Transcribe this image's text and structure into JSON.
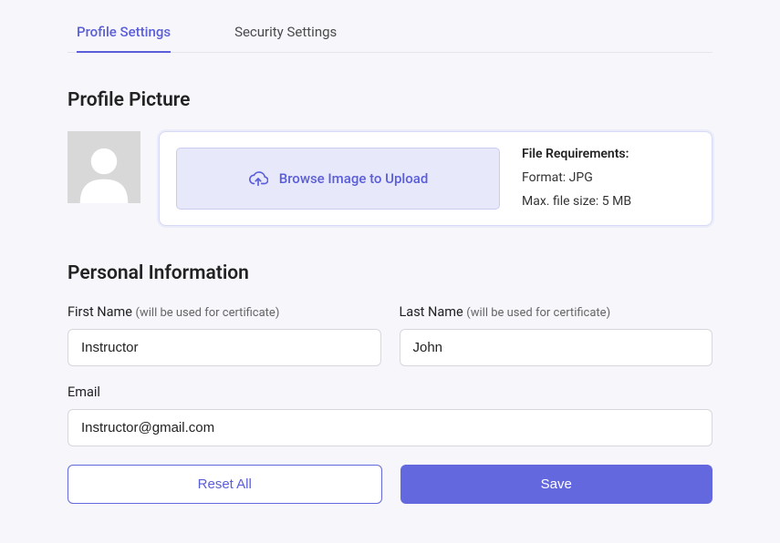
{
  "tabs": {
    "profile": "Profile Settings",
    "security": "Security Settings"
  },
  "profile_picture": {
    "title": "Profile Picture",
    "browse_label": "Browse Image to Upload",
    "req_title": "File Requirements:",
    "req_format": "Format: JPG",
    "req_size": "Max. file size: 5 MB"
  },
  "personal_info": {
    "title": "Personal Information",
    "first_name_label": "First Name",
    "first_name_hint": "(will be used for certificate)",
    "first_name_value": "Instructor",
    "last_name_label": "Last Name",
    "last_name_hint": "(will be used for certificate)",
    "last_name_value": "John",
    "email_label": "Email",
    "email_value": "Instructor@gmail.com"
  },
  "buttons": {
    "reset": "Reset All",
    "save": "Save"
  }
}
